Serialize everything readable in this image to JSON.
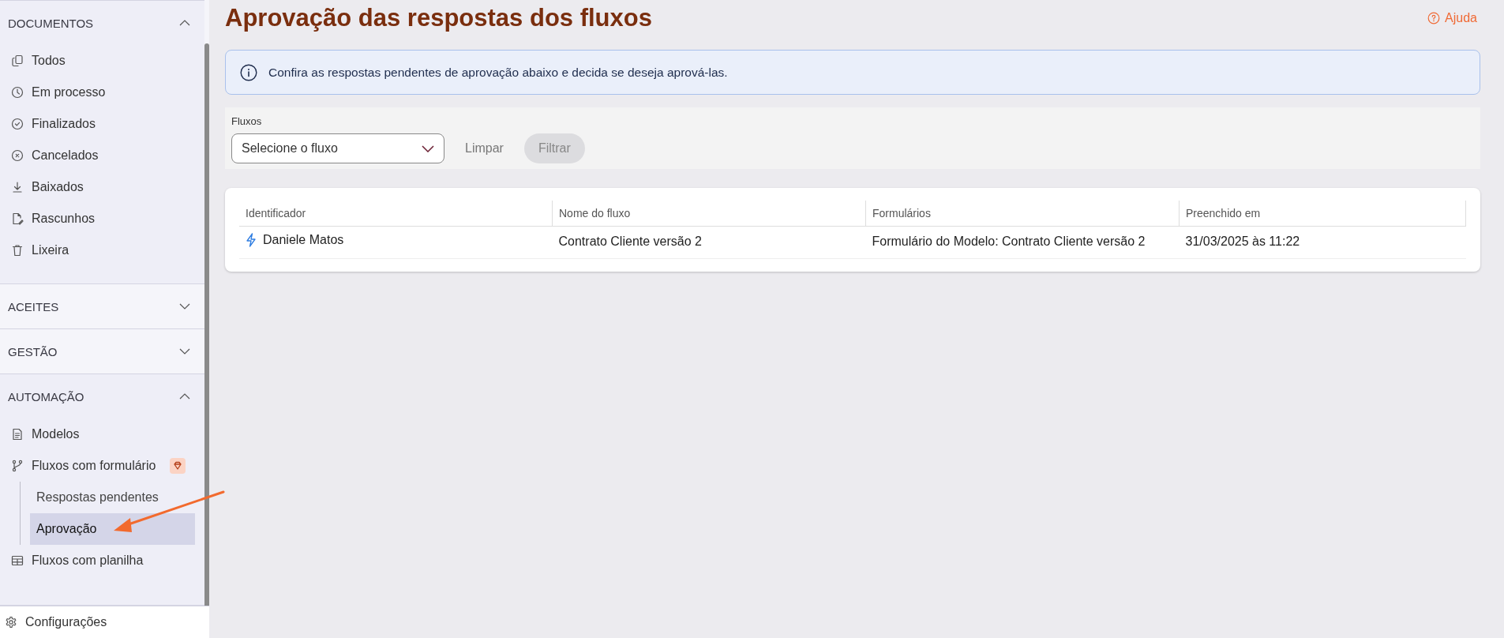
{
  "sidebar": {
    "sections": [
      {
        "title": "DOCUMENTOS",
        "expanded": true,
        "items": [
          {
            "label": "Todos",
            "selected": false
          },
          {
            "label": "Em processo",
            "selected": false
          },
          {
            "label": "Finalizados",
            "selected": false
          },
          {
            "label": "Cancelados",
            "selected": false
          },
          {
            "label": "Baixados",
            "selected": false
          },
          {
            "label": "Rascunhos",
            "selected": false
          },
          {
            "label": "Lixeira",
            "selected": false
          }
        ]
      },
      {
        "title": "ACEITES",
        "expanded": false
      },
      {
        "title": "GESTÃO",
        "expanded": false
      },
      {
        "title": "AUTOMAÇÃO",
        "expanded": true,
        "items": [
          {
            "label": "Modelos",
            "selected": false
          },
          {
            "label": "Fluxos com formulário",
            "selected": false,
            "premium": true,
            "children": [
              {
                "label": "Respostas pendentes",
                "selected": false
              },
              {
                "label": "Aprovação",
                "selected": true
              }
            ]
          },
          {
            "label": "Fluxos com planilha",
            "selected": false
          }
        ]
      }
    ],
    "footer": {
      "label": "Configurações"
    }
  },
  "page": {
    "title": "Aprovação das respostas dos fluxos",
    "help": "Ajuda",
    "info": "Confira as respostas pendentes de aprovação abaixo e decida se deseja aprová-las."
  },
  "filters": {
    "label": "Fluxos",
    "select": {
      "placeholder": "Selecione o fluxo"
    },
    "clear": "Limpar",
    "apply": {
      "label": "Filtrar",
      "disabled": true
    }
  },
  "table": {
    "columns": [
      "Identificador",
      "Nome do fluxo",
      "Formulários",
      "Preenchido em"
    ],
    "rows": [
      {
        "cells": [
          "Daniele Matos",
          "Contrato Cliente versão 2",
          "Formulário do Modelo: Contrato Cliente versão 2",
          "31/03/2025 às 11:22"
        ]
      }
    ]
  }
}
